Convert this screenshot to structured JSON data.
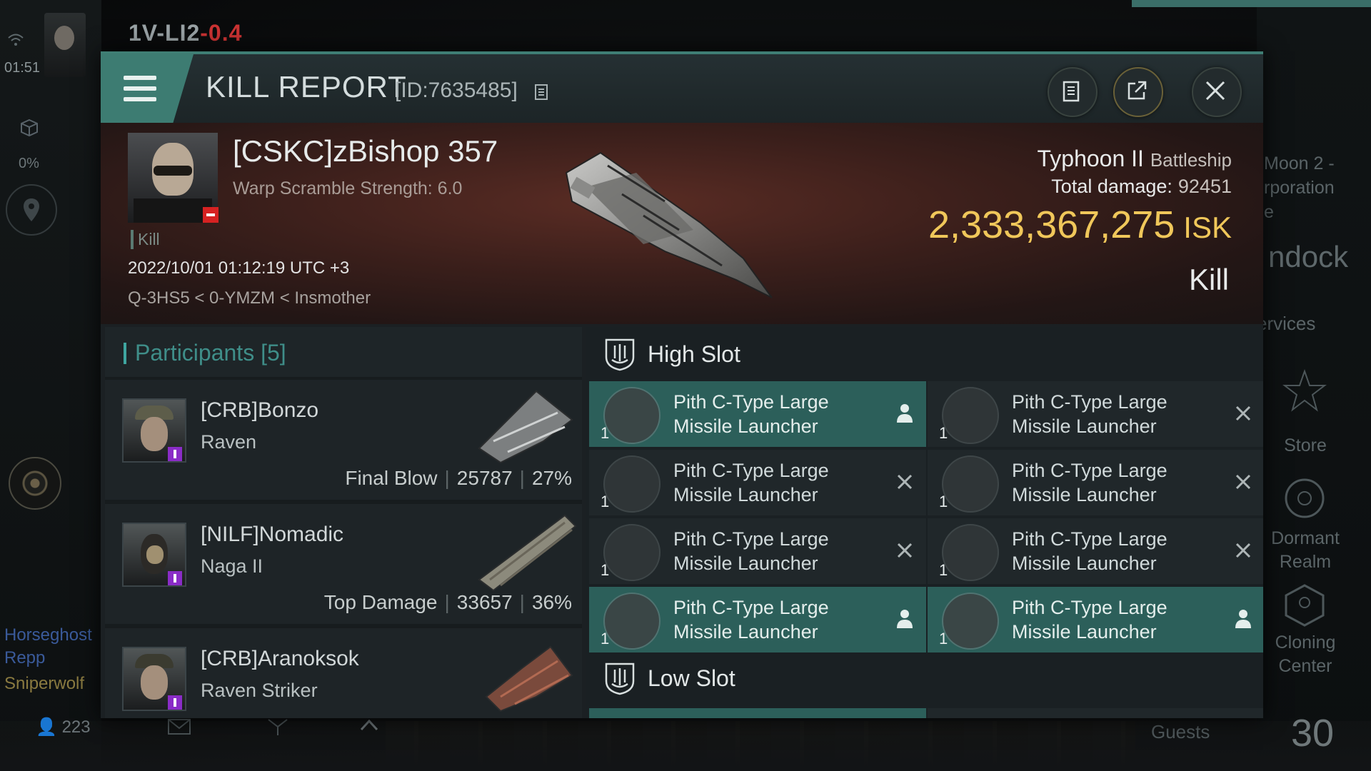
{
  "hud": {
    "system_name": "1V-LI2",
    "system_sec": "-0.4",
    "time": "01:51",
    "cargo_pct": "0%",
    "chat_line1": "Horseghost",
    "chat_line2": "Repp",
    "chat_line3": "Sniperwolf",
    "local_count": "223"
  },
  "right_hud": {
    "moon_label": "Moon 2 -\nrporation\ne",
    "undock": "ndock",
    "services": "ervices",
    "store": "Store",
    "dormant": "Dormant\nRealm",
    "cloning": "Cloning\nCenter",
    "guests": "Guests",
    "count": "30"
  },
  "dialog": {
    "title": "KILL REPORT",
    "id_text": "[ID:7635485]"
  },
  "victim": {
    "name": "[CSKC]zBishop 357",
    "warp": "Warp Scramble Strength: 6.0",
    "tag": "Kill",
    "date": "2022/10/01 01:12:19 UTC +3",
    "location": "Q-3HS5 < 0-YMZM < Insmother",
    "ship": "Typhoon II",
    "ship_class": "Battleship",
    "total_damage_label": "Total damage:",
    "total_damage": "92451",
    "isk_value": "2,333,367,275",
    "isk_unit": "ISK",
    "result": "Kill"
  },
  "participants": {
    "title": "Participants [5]",
    "rows": [
      {
        "name": "[CRB]Bonzo",
        "ship": "Raven",
        "label": "Final Blow",
        "damage": "25787",
        "pct": "27%"
      },
      {
        "name": "[NILF]Nomadic",
        "ship": "Naga II",
        "label": "Top Damage",
        "damage": "33657",
        "pct": "36%"
      },
      {
        "name": "[CRB]Aranoksok",
        "ship": "Raven Striker",
        "label": "",
        "damage": "",
        "pct": ""
      }
    ]
  },
  "slots": {
    "high_title": "High Slot",
    "low_title": "Low Slot",
    "high": [
      {
        "name": "Pith C-Type Large Missile Launcher",
        "qty": "1",
        "status": "pilot-icon",
        "fitted": true
      },
      {
        "name": "Pith C-Type Large Missile Launcher",
        "qty": "1",
        "status": "destroyed-icon",
        "fitted": false
      },
      {
        "name": "Pith C-Type Large Missile Launcher",
        "qty": "1",
        "status": "destroyed-icon",
        "fitted": false
      },
      {
        "name": "Pith C-Type Large Missile Launcher",
        "qty": "1",
        "status": "destroyed-icon",
        "fitted": false
      },
      {
        "name": "Pith C-Type Large Missile Launcher",
        "qty": "1",
        "status": "destroyed-icon",
        "fitted": false
      },
      {
        "name": "Pith C-Type Large Missile Launcher",
        "qty": "1",
        "status": "destroyed-icon",
        "fitted": false
      },
      {
        "name": "Pith C-Type Large Missile Launcher",
        "qty": "1",
        "status": "pilot-icon",
        "fitted": true
      },
      {
        "name": "Pith C-Type Large Missile Launcher",
        "qty": "1",
        "status": "pilot-icon",
        "fitted": true
      }
    ]
  },
  "colors": {
    "accent": "#3d7c72",
    "isk": "#f0c75a",
    "danger": "#d62222",
    "badge": "#8a2cc7"
  }
}
